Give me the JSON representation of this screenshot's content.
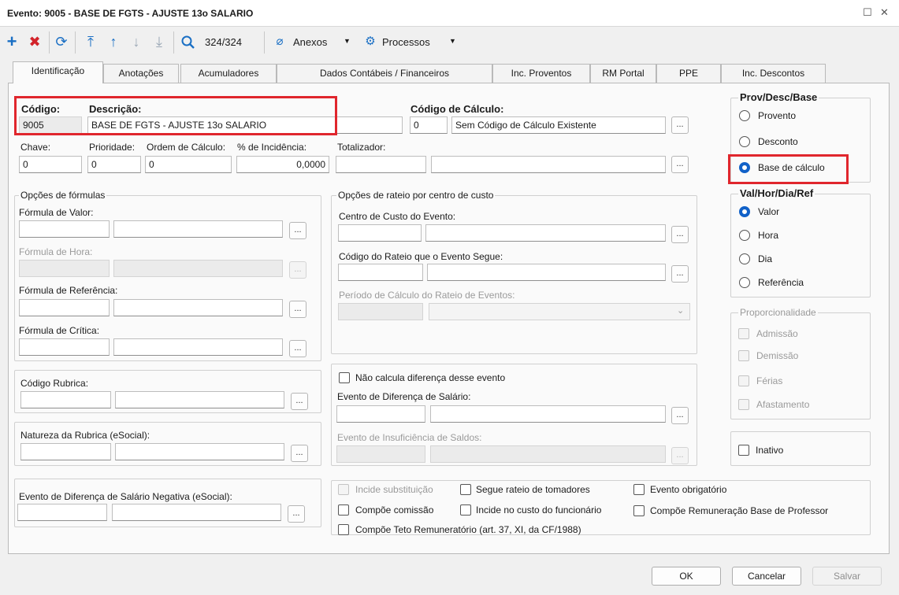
{
  "window": {
    "title": "Evento: 9005 - BASE DE FGTS - AJUSTE 13o SALARIO",
    "maximize_glyph": "☐",
    "close_glyph": "✕"
  },
  "toolbar": {
    "record_counter": "324/324",
    "anexos_label": "Anexos",
    "processos_label": "Processos",
    "icons": [
      "add-icon",
      "delete-icon",
      "refresh-icon",
      "first-record-icon",
      "previous-record-icon",
      "next-record-icon",
      "last-record-icon",
      "search-icon",
      "paperclip-icon",
      "gear-icon"
    ]
  },
  "tabs": [
    "Identificação",
    "Anotações",
    "Acumuladores",
    "Dados Contábeis / Financeiros",
    "Inc. Proventos",
    "RM Portal",
    "PPE",
    "Inc. Descontos"
  ],
  "identificacao": {
    "codigo_label": "Código:",
    "codigo_value": "9005",
    "descricao_label": "Descrição:",
    "descricao_value": "BASE DE FGTS - AJUSTE 13o SALARIO",
    "codigo_calculo_label": "Código de Cálculo:",
    "codigo_calculo_value": "0",
    "codigo_calculo_desc": "Sem Código de Cálculo Existente",
    "chave_label": "Chave:",
    "chave_value": "0",
    "prioridade_label": "Prioridade:",
    "prioridade_value": "0",
    "ordem_label": "Ordem de Cálculo:",
    "ordem_value": "0",
    "incidencia_label": "% de Incidência:",
    "incidencia_value": "0,0000",
    "totalizador_label": "Totalizador:"
  },
  "formulas": {
    "group_title": "Opções de fórmulas",
    "valor_label": "Fórmula de Valor:",
    "hora_label": "Fórmula de Hora:",
    "referencia_label": "Fórmula de Referência:",
    "critica_label": "Fórmula de Crítica:"
  },
  "rubrica": {
    "codigo_label": "Código Rubrica:",
    "natureza_label": "Natureza da Rubrica (eSocial):",
    "diferenca_negativa_label": "Evento de Diferença de Salário Negativa (eSocial):"
  },
  "rateio": {
    "group_title": "Opções de rateio por centro de custo",
    "centro_custo_label": "Centro de Custo do Evento:",
    "codigo_rateio_label": "Código do Rateio que o Evento Segue:",
    "periodo_label": "Período de Cálculo do Rateio de Eventos:"
  },
  "diferenca": {
    "nao_calcula_label": "Não calcula diferença desse evento",
    "evento_diferenca_label": "Evento de Diferença de Salário:",
    "evento_insuficiencia_label": "Evento de Insuficiência de Saldos:"
  },
  "prov_desc_base": {
    "title": "Prov/Desc/Base",
    "options": [
      "Provento",
      "Desconto",
      "Base de cálculo"
    ],
    "selected": "Base de cálculo"
  },
  "val_hor": {
    "title": "Val/Hor/Dia/Ref",
    "options": [
      "Valor",
      "Hora",
      "Dia",
      "Referência"
    ],
    "selected": "Valor"
  },
  "proporcionalidade": {
    "title": "Proporcionalidade",
    "options": [
      "Admissão",
      "Demissão",
      "Férias",
      "Afastamento"
    ]
  },
  "inativo_label": "Inativo",
  "flags": {
    "incide_substituicao": "Incide substituição",
    "segue_rateio": "Segue rateio de tomadores",
    "evento_obrigatorio": "Evento obrigatório",
    "compoe_comissao": "Compõe comissão",
    "incide_custo": "Incide no custo do funcionário",
    "compoe_remuneracao": "Compõe Remuneração Base de Professor",
    "compoe_teto": "Compõe Teto Remuneratório (art. 37, XI, da CF/1988)"
  },
  "footer": {
    "ok": "OK",
    "cancelar": "Cancelar",
    "salvar": "Salvar"
  },
  "colors": {
    "accent": "#1161c8",
    "highlight_box": "#e0262d",
    "add_icon": "#1a6fc4",
    "delete_icon": "#d2232a"
  },
  "dots": "..."
}
